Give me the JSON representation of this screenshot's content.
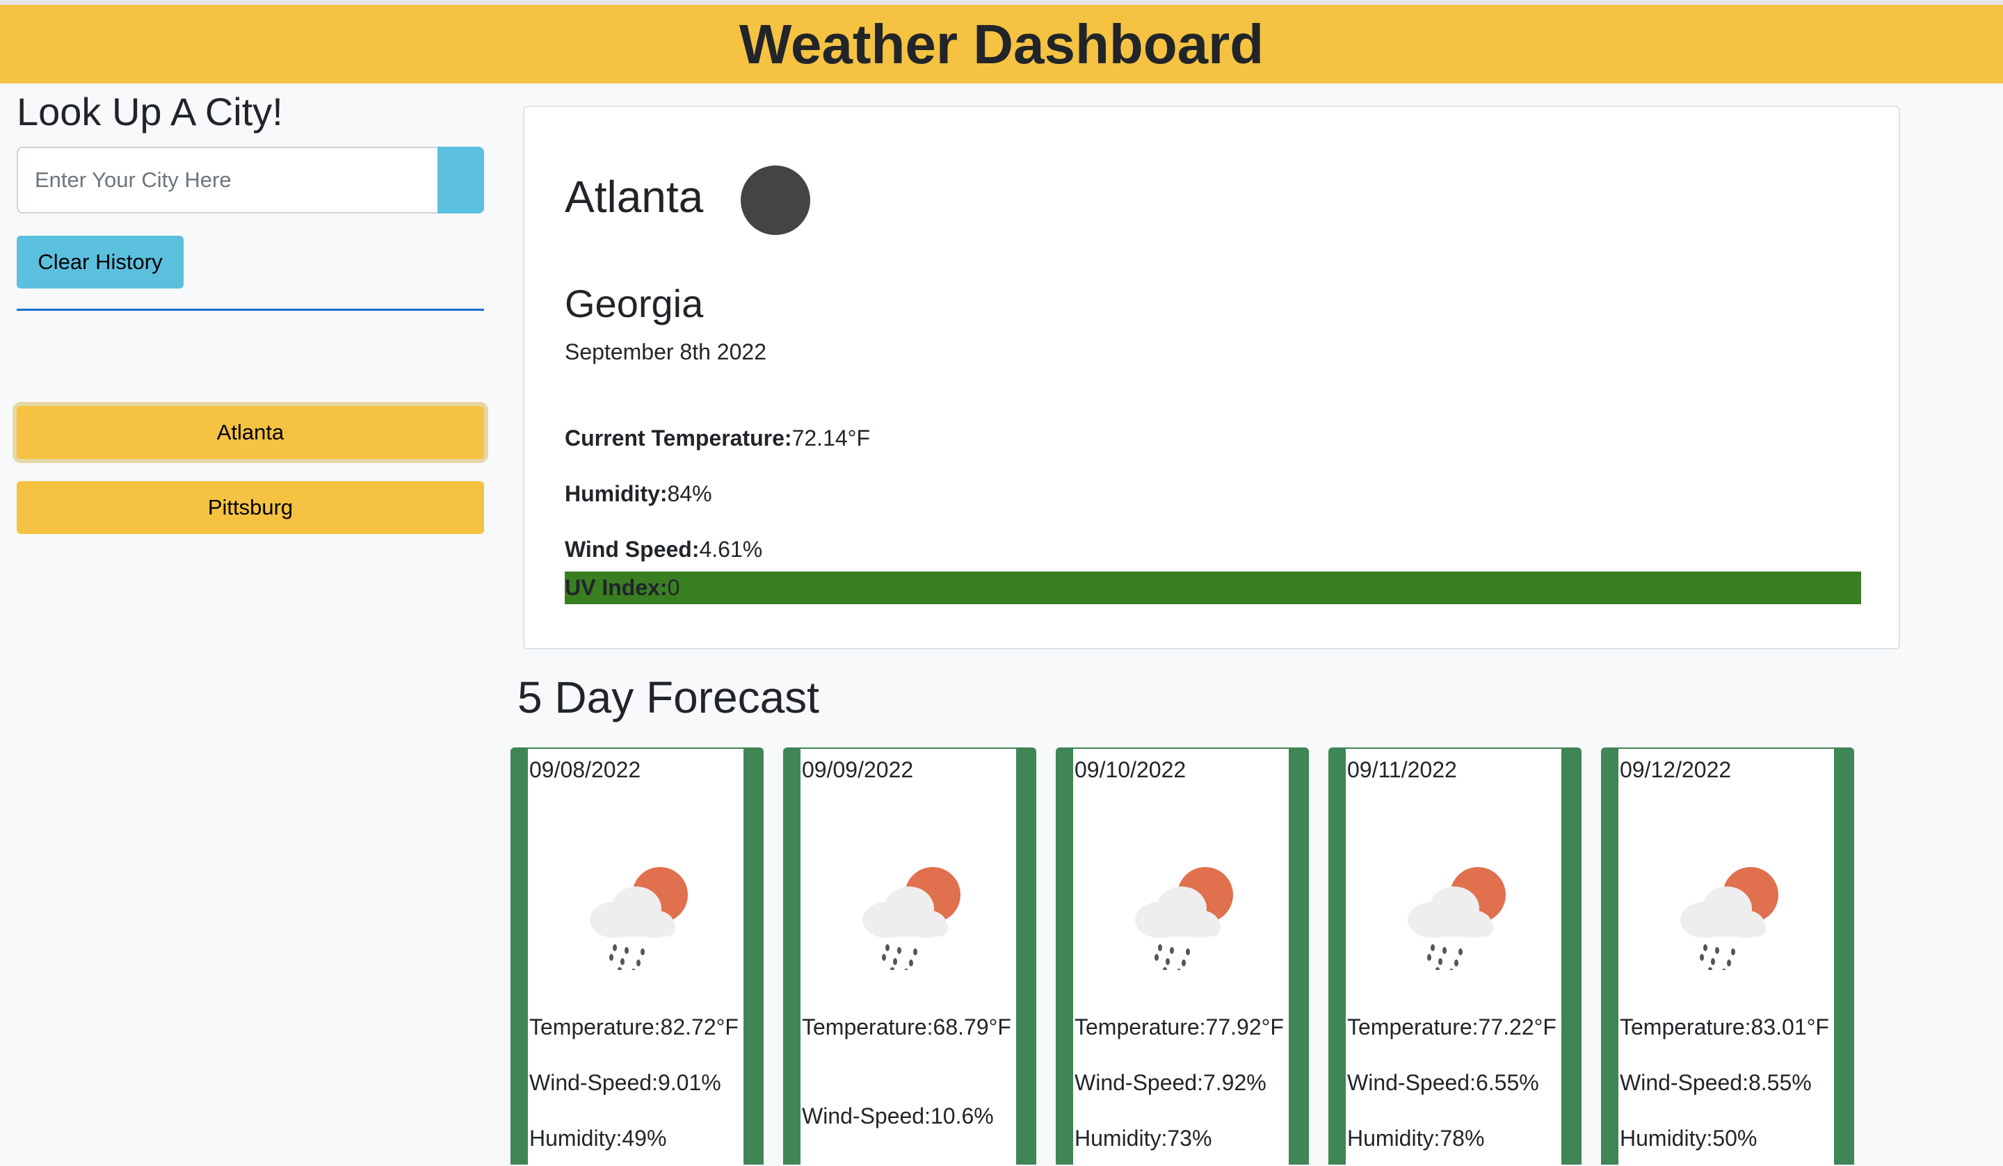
{
  "header": {
    "title": "Weather Dashboard"
  },
  "sidebar": {
    "title": "Look Up A City!",
    "search_placeholder": "Enter Your City Here",
    "search_value": "",
    "clear_label": "Clear History",
    "history": [
      {
        "label": "Atlanta",
        "active": true
      },
      {
        "label": "Pittsburg",
        "active": false
      }
    ]
  },
  "current": {
    "city": "Atlanta",
    "state": "Georgia",
    "date": "September 8th 2022",
    "temperature_label": "Current Temperature:",
    "temperature_value": "72.14°F",
    "humidity_label": "Humidity:",
    "humidity_value": "84%",
    "wind_label": "Wind Speed:",
    "wind_value": "4.61%",
    "uv_label": "UV Index:",
    "uv_value": "0",
    "uv_color": "#3a7e22"
  },
  "forecast": {
    "title": "5 Day Forecast",
    "card_color": "#3f8556",
    "icon": "rain-sun-cloud-icon",
    "days": [
      {
        "date": "09/08/2022",
        "temperature": "Temperature:82.72°F",
        "wind": "Wind-Speed:9.01%",
        "humidity": "Humidity:49%"
      },
      {
        "date": "09/09/2022",
        "temperature": "Temperature:68.79°F",
        "wind": "Wind-Speed:10.6%",
        "humidity": ""
      },
      {
        "date": "09/10/2022",
        "temperature": "Temperature:77.92°F",
        "wind": "Wind-Speed:7.92%",
        "humidity": "Humidity:73%"
      },
      {
        "date": "09/11/2022",
        "temperature": "Temperature:77.22°F",
        "wind": "Wind-Speed:6.55%",
        "humidity": "Humidity:78%"
      },
      {
        "date": "09/12/2022",
        "temperature": "Temperature:83.01°F",
        "wind": "Wind-Speed:8.55%",
        "humidity": "Humidity:50%"
      }
    ]
  }
}
